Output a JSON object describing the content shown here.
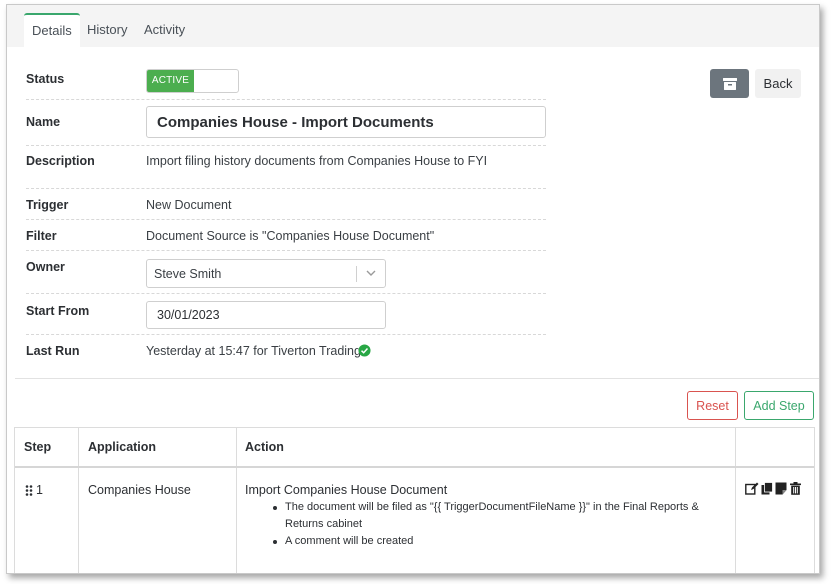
{
  "tabs": [
    {
      "label": "Details",
      "active": true
    },
    {
      "label": "History",
      "active": false
    },
    {
      "label": "Activity",
      "active": false
    }
  ],
  "form": {
    "status": {
      "label": "Status",
      "value": "ACTIVE"
    },
    "name": {
      "label": "Name",
      "value": "Companies House - Import Documents"
    },
    "description": {
      "label": "Description",
      "value": "Import filing history documents from Companies House to FYI"
    },
    "trigger": {
      "label": "Trigger",
      "value": "New Document"
    },
    "filter": {
      "label": "Filter",
      "value": "Document Source is \"Companies House Document\""
    },
    "owner": {
      "label": "Owner",
      "value": "Steve Smith"
    },
    "start_from": {
      "label": "Start From",
      "value": "30/01/2023"
    },
    "last_run": {
      "label": "Last Run",
      "value": "Yesterday at 15:47 for Tiverton Trading",
      "status_icon": "check-circle-icon"
    }
  },
  "header_buttons": {
    "archive_icon": "archive-icon",
    "back_label": "Back"
  },
  "step_buttons": {
    "reset_label": "Reset",
    "add_step_label": "Add Step"
  },
  "steps_table": {
    "columns": [
      "Step",
      "Application",
      "Action"
    ],
    "rows": [
      {
        "step": "1",
        "application": "Companies House",
        "action_title": "Import Companies House Document",
        "action_details": [
          "The document will be filed as \"{{ TriggerDocumentFileName }}\" in the Final Reports &",
          "Returns cabinet",
          "A comment will be created"
        ],
        "row_icons": [
          "edit-icon",
          "copy-icon",
          "note-icon",
          "trash-icon"
        ]
      }
    ]
  },
  "colors": {
    "accent_green": "#3aa76d",
    "active_toggle": "#4cae4f",
    "reset_red": "#d9534f",
    "archive_gray": "#6c757d"
  }
}
